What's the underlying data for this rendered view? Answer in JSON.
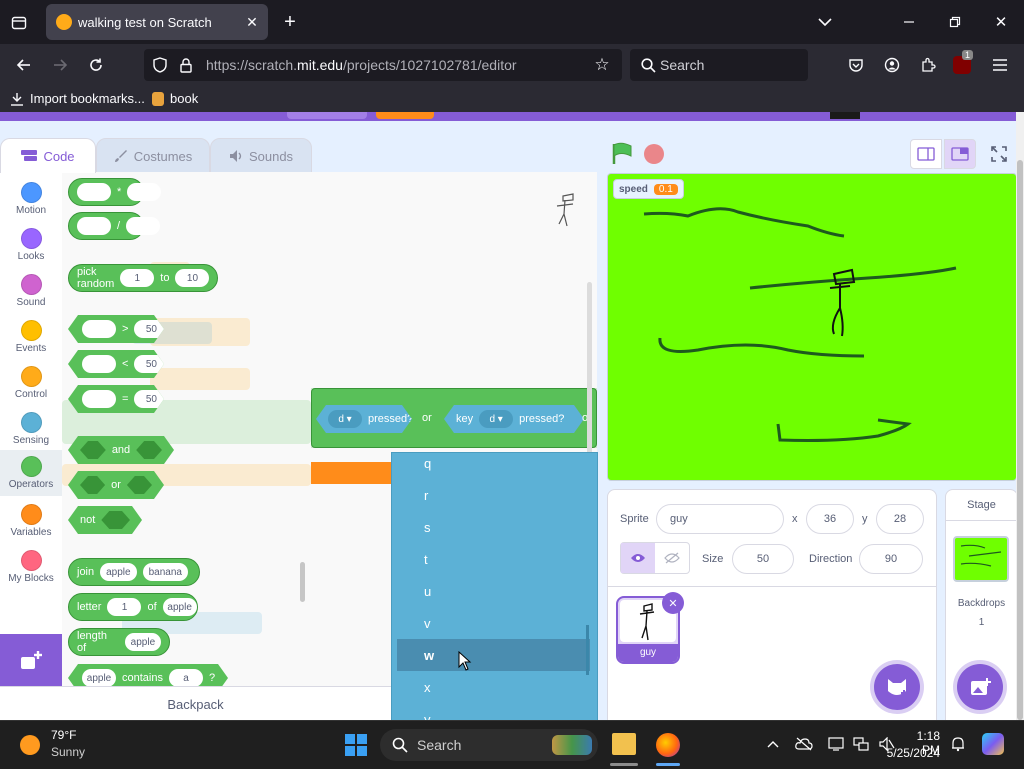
{
  "browser": {
    "tab_title": "walking test on Scratch",
    "url_prefix": "https://scratch.",
    "url_domain": "mit.edu",
    "url_path": "/projects/1027102781/editor",
    "search_placeholder": "Search",
    "notification_badge": "1",
    "bookmarks": [
      "Import bookmarks...",
      "book"
    ],
    "icons": {
      "tab_list": "tab-list-icon",
      "favicon": "scratch-favicon-icon",
      "tab_close": "close-icon",
      "new_tab": "plus-icon",
      "tabs_dropdown": "chevron-down-icon",
      "minimize": "minimize-icon",
      "maximize": "maximize-icon",
      "close_window": "close-icon",
      "back": "back-arrow-icon",
      "forward": "forward-arrow-icon",
      "reload": "reload-icon",
      "shield": "shield-icon",
      "lock": "lock-icon",
      "bookmark_star": "star-icon",
      "pocket": "pocket-icon",
      "account": "account-icon",
      "extensions": "puzzle-icon",
      "ublock": "ublock-icon",
      "menu": "hamburger-icon"
    }
  },
  "scratch": {
    "tabs": {
      "code": "Code",
      "costumes": "Costumes",
      "sounds": "Sounds"
    },
    "categories": [
      {
        "label": "Motion",
        "color": "#4c97ff"
      },
      {
        "label": "Looks",
        "color": "#9966ff"
      },
      {
        "label": "Sound",
        "color": "#cf63cf"
      },
      {
        "label": "Events",
        "color": "#ffbf00"
      },
      {
        "label": "Control",
        "color": "#ffab19"
      },
      {
        "label": "Sensing",
        "color": "#5cb1d6"
      },
      {
        "label": "Operators",
        "color": "#59c059"
      },
      {
        "label": "Variables",
        "color": "#ff8c1a"
      },
      {
        "label": "My Blocks",
        "color": "#ff6680"
      }
    ],
    "palette": {
      "multiply_op": "*",
      "divide_op": "/",
      "pick_random": {
        "label": "pick random",
        "from": "1",
        "to_label": "to",
        "to": "10"
      },
      "gt": {
        "op": ">",
        "value": "50"
      },
      "lt": {
        "op": "<",
        "value": "50"
      },
      "eq": {
        "op": "=",
        "value": "50"
      },
      "and_label": "and",
      "or_label": "or",
      "not_label": "not",
      "join": {
        "label": "join",
        "a": "apple",
        "b": "banana"
      },
      "letter": {
        "label": "letter",
        "index": "1",
        "of_label": "of",
        "word": "apple"
      },
      "length_of": {
        "label": "length of",
        "word": "apple"
      },
      "contains": {
        "word": "apple",
        "label": "contains",
        "letter": "a",
        "q": "?"
      }
    },
    "workspace": {
      "key1": "d",
      "pressed1": "pressed?",
      "or_label": "or",
      "key_label": "key",
      "key2": "d",
      "pressed2": "pressed?",
      "trailing_or": "or"
    },
    "dropdown_items": [
      "q",
      "r",
      "s",
      "t",
      "u",
      "v",
      "w",
      "x",
      "y"
    ],
    "dropdown_selected": "w",
    "backpack": "Backpack",
    "stage": {
      "monitor_label": "speed",
      "monitor_value": "0.1"
    },
    "sprite_info": {
      "sprite_label": "Sprite",
      "sprite_name": "guy",
      "x_label": "x",
      "x": "36",
      "y_label": "y",
      "y": "28",
      "show_label": "Show",
      "size_label": "Size",
      "size": "50",
      "direction_label": "Direction",
      "direction": "90"
    },
    "sprites": [
      {
        "name": "guy"
      }
    ],
    "stage_pane": {
      "title": "Stage",
      "backdrops_label": "Backdrops",
      "backdrops_count": "1"
    }
  },
  "taskbar": {
    "weather_temp": "79°F",
    "weather_desc": "Sunny",
    "search_placeholder": "Search",
    "time": "1:18 PM",
    "date": "5/25/2024"
  }
}
